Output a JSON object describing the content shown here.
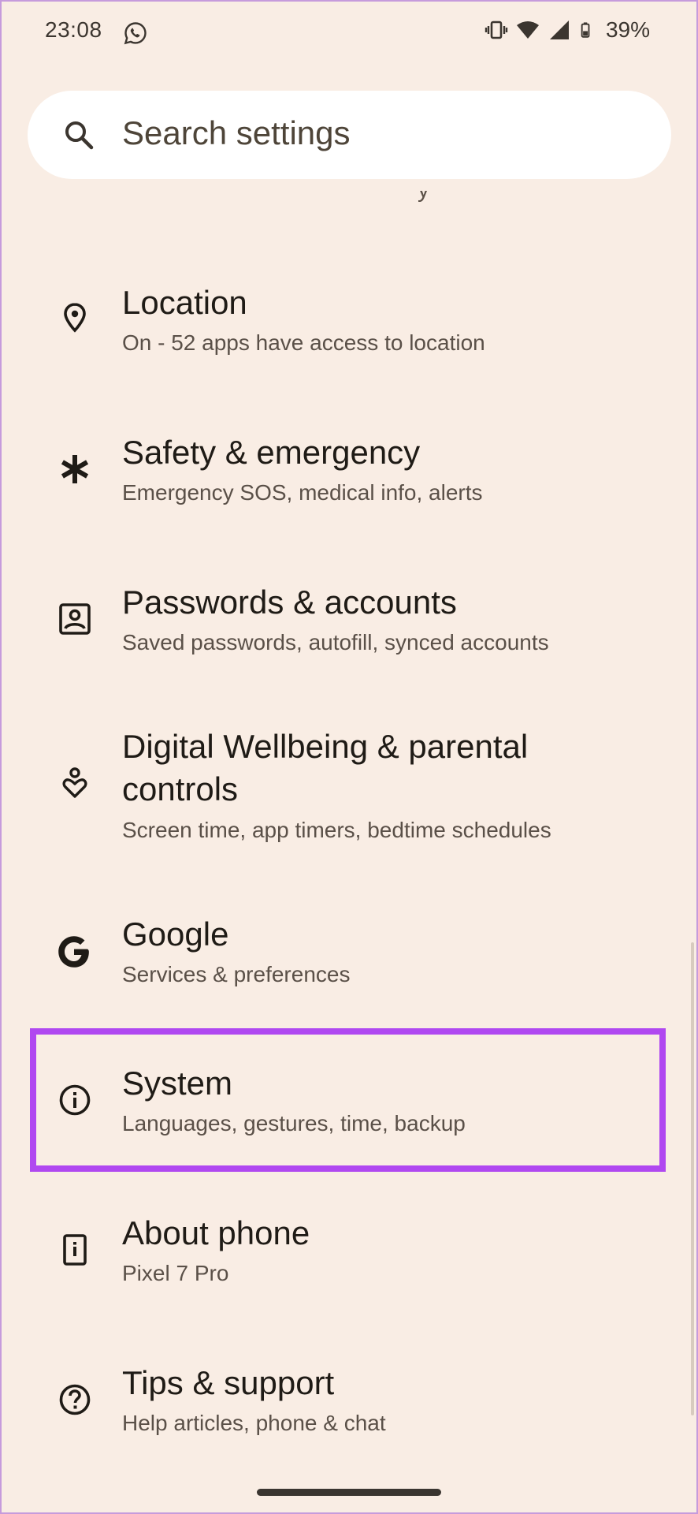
{
  "status_bar": {
    "time": "23:08",
    "battery": "39%",
    "icons": [
      "whatsapp-icon",
      "vibrate-icon",
      "wifi-icon",
      "signal-icon",
      "battery-icon"
    ]
  },
  "search": {
    "placeholder": "Search settings"
  },
  "partial_top_item": "y /",
  "items": [
    {
      "title": "Location",
      "subtitle": "On - 52 apps have access to location",
      "icon": "location-pin-icon"
    },
    {
      "title": "Safety & emergency",
      "subtitle": "Emergency SOS, medical info, alerts",
      "icon": "asterisk-icon"
    },
    {
      "title": "Passwords & accounts",
      "subtitle": "Saved passwords, autofill, synced accounts",
      "icon": "account-box-icon"
    },
    {
      "title_line1": "Digital Wellbeing & parental",
      "title_line2": "controls",
      "subtitle": "Screen time, app timers, bedtime schedules",
      "icon": "wellbeing-icon"
    },
    {
      "title": "Google",
      "subtitle": "Services & preferences",
      "icon": "google-g-icon"
    },
    {
      "title": "System",
      "subtitle": "Languages, gestures, time, backup",
      "icon": "info-icon",
      "highlighted": true
    },
    {
      "title": "About phone",
      "subtitle": "Pixel 7 Pro",
      "icon": "phone-info-icon"
    },
    {
      "title": "Tips & support",
      "subtitle": "Help articles, phone & chat",
      "icon": "help-circle-icon"
    }
  ],
  "colors": {
    "background": "#f9ede4",
    "highlight_border": "#b048f0",
    "title_text": "#1f1b16",
    "subtitle_text": "#5a5048"
  }
}
